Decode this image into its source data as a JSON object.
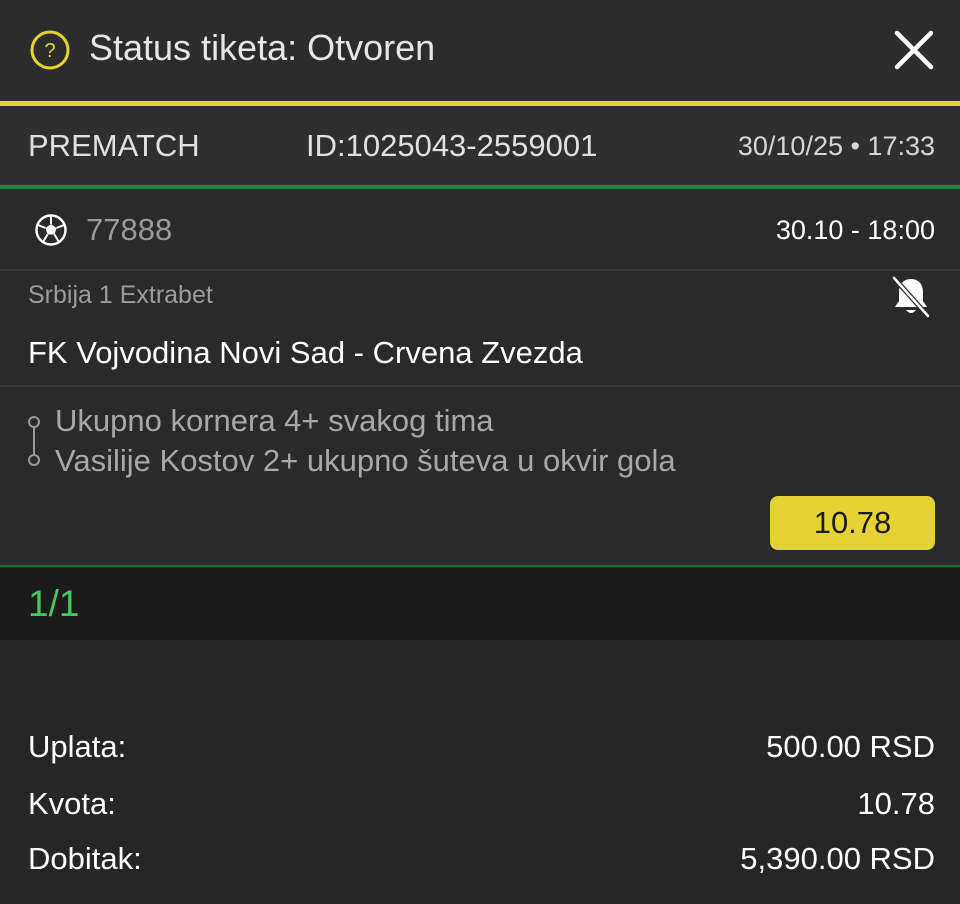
{
  "header": {
    "title": "Status tiketa: Otvoren",
    "help_icon": "question-circle-icon",
    "close_icon": "close-icon",
    "accent_color": "#e5d22b"
  },
  "ticket": {
    "type": "PREMATCH",
    "id": "ID:1025043-2559001",
    "datetime": "30/10/25 • 17:33"
  },
  "event": {
    "sport_icon": "soccer-ball-icon",
    "code": "77888",
    "time": "30.10  -  18:00",
    "league": "Srbija 1 Extrabet",
    "notification_icon": "bell-off-icon",
    "match": "FK Vojvodina Novi Sad - Crvena Zvezda",
    "selections": [
      "Ukupno kornera 4+ svakog tima",
      "Vasilije Kostov 2+ ukupno šuteva u okvir gola"
    ],
    "odds": "10.78"
  },
  "count": {
    "text": "1/1",
    "color": "#3ecc5a"
  },
  "summary": {
    "rows": [
      {
        "label": "Uplata:",
        "value": "500.00 RSD"
      },
      {
        "label": "Kvota:",
        "value": "10.78"
      },
      {
        "label": "Dobitak:",
        "value": "5,390.00 RSD"
      }
    ]
  }
}
